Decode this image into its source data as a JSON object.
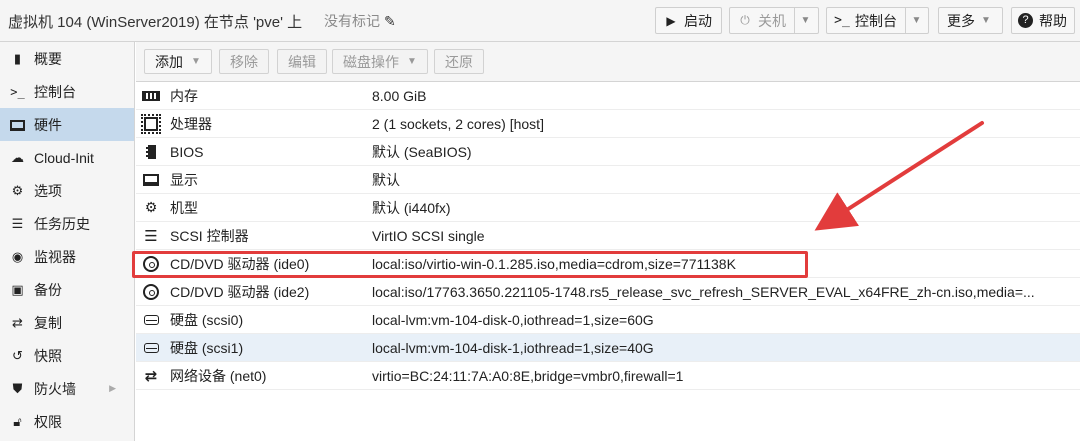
{
  "header": {
    "title": "虚拟机 104 (WinServer2019) 在节点 'pve' 上",
    "tags_label": "没有标记",
    "buttons": {
      "start": "启动",
      "shutdown": "关机",
      "console": "控制台",
      "more": "更多",
      "help": "帮助"
    }
  },
  "sidebar": {
    "items": [
      {
        "label": "概要",
        "icon": "book-icon"
      },
      {
        "label": "控制台",
        "icon": "terminal-icon"
      },
      {
        "label": "硬件",
        "icon": "desktop-icon"
      },
      {
        "label": "Cloud-Init",
        "icon": "cloud-icon"
      },
      {
        "label": "选项",
        "icon": "gear-icon"
      },
      {
        "label": "任务历史",
        "icon": "list-icon"
      },
      {
        "label": "监视器",
        "icon": "eye-icon"
      },
      {
        "label": "备份",
        "icon": "floppy-icon"
      },
      {
        "label": "复制",
        "icon": "retweet-icon"
      },
      {
        "label": "快照",
        "icon": "history-icon"
      },
      {
        "label": "防火墙",
        "icon": "shield-icon"
      },
      {
        "label": "权限",
        "icon": "unlock-icon"
      }
    ],
    "active_index": 2
  },
  "toolbar": {
    "add": "添加",
    "remove": "移除",
    "edit": "编辑",
    "disk_action": "磁盘操作",
    "revert": "还原"
  },
  "hardware": {
    "rows": [
      {
        "icon": "memory-icon",
        "name": "内存",
        "value": "8.00 GiB"
      },
      {
        "icon": "cpu-icon",
        "name": "处理器",
        "value": "2 (1 sockets, 2 cores) [host]"
      },
      {
        "icon": "microchip-icon",
        "name": "BIOS",
        "value": "默认 (SeaBIOS)"
      },
      {
        "icon": "monitor-icon",
        "name": "显示",
        "value": "默认"
      },
      {
        "icon": "gears-icon",
        "name": "机型",
        "value": "默认 (i440fx)"
      },
      {
        "icon": "database-icon",
        "name": "SCSI 控制器",
        "value": "VirtIO SCSI single"
      },
      {
        "icon": "cdrom-icon",
        "name": "CD/DVD 驱动器 (ide0)",
        "value": "local:iso/virtio-win-0.1.285.iso,media=cdrom,size=771138K"
      },
      {
        "icon": "cdrom-icon",
        "name": "CD/DVD 驱动器 (ide2)",
        "value": "local:iso/17763.3650.221105-1748.rs5_release_svc_refresh_SERVER_EVAL_x64FRE_zh-cn.iso,media=..."
      },
      {
        "icon": "hdd-icon",
        "name": "硬盘 (scsi0)",
        "value": "local-lvm:vm-104-disk-0,iothread=1,size=60G"
      },
      {
        "icon": "hdd-icon",
        "name": "硬盘 (scsi1)",
        "value": "local-lvm:vm-104-disk-1,iothread=1,size=40G"
      },
      {
        "icon": "exchange-icon",
        "name": "网络设备 (net0)",
        "value": "virtio=BC:24:11:7A:A0:8E,bridge=vmbr0,firewall=1"
      }
    ],
    "selected_index": 9
  },
  "colors": {
    "annotation": "#e23c3c",
    "selected_nav": "#c5d9ec",
    "selected_row": "#e8f0f8"
  }
}
